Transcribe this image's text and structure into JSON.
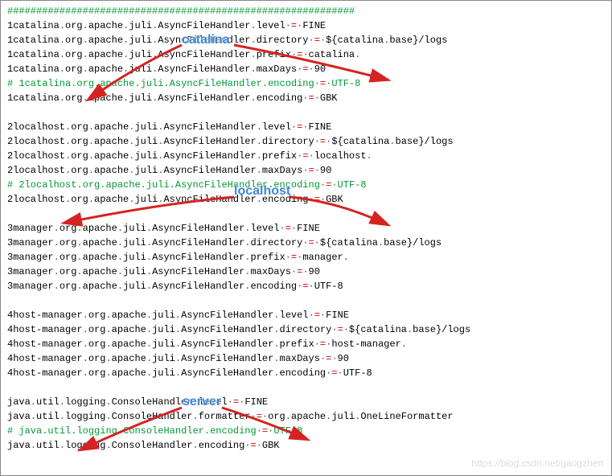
{
  "hash_line": "############################################################",
  "sections": [
    {
      "paragraph_sep_before": false,
      "lines": [
        {
          "type": "prop",
          "text": "1catalina.org.apache.juli.AsyncFileHandler.level = FINE"
        },
        {
          "type": "prop",
          "text": "1catalina.org.apache.juli.AsyncFileHandler.directory = ${catalina.base}/logs"
        },
        {
          "type": "prop",
          "text": "1catalina.org.apache.juli.AsyncFileHandler.prefix = catalina."
        },
        {
          "type": "prop",
          "text": "1catalina.org.apache.juli.AsyncFileHandler.maxDays = 90"
        },
        {
          "type": "comment",
          "text": "# 1catalina.org.apache.juli.AsyncFileHandler.encoding = UTF-8"
        },
        {
          "type": "prop",
          "text": "1catalina.org.apache.juli.AsyncFileHandler.encoding = GBK"
        }
      ]
    },
    {
      "paragraph_sep_before": true,
      "lines": [
        {
          "type": "prop",
          "text": "2localhost.org.apache.juli.AsyncFileHandler.level = FINE"
        },
        {
          "type": "prop",
          "text": "2localhost.org.apache.juli.AsyncFileHandler.directory = ${catalina.base}/logs"
        },
        {
          "type": "prop",
          "text": "2localhost.org.apache.juli.AsyncFileHandler.prefix = localhost."
        },
        {
          "type": "prop",
          "text": "2localhost.org.apache.juli.AsyncFileHandler.maxDays = 90"
        },
        {
          "type": "comment",
          "text": "# 2localhost.org.apache.juli.AsyncFileHandler.encoding = UTF-8"
        },
        {
          "type": "prop",
          "text": "2localhost.org.apache.juli.AsyncFileHandler.encoding = GBK"
        }
      ]
    },
    {
      "paragraph_sep_before": true,
      "lines": [
        {
          "type": "prop",
          "text": "3manager.org.apache.juli.AsyncFileHandler.level = FINE"
        },
        {
          "type": "prop",
          "text": "3manager.org.apache.juli.AsyncFileHandler.directory = ${catalina.base}/logs"
        },
        {
          "type": "prop",
          "text": "3manager.org.apache.juli.AsyncFileHandler.prefix = manager."
        },
        {
          "type": "prop",
          "text": "3manager.org.apache.juli.AsyncFileHandler.maxDays = 90"
        },
        {
          "type": "prop",
          "text": "3manager.org.apache.juli.AsyncFileHandler.encoding = UTF-8"
        }
      ]
    },
    {
      "paragraph_sep_before": true,
      "lines": [
        {
          "type": "prop",
          "text": "4host-manager.org.apache.juli.AsyncFileHandler.level = FINE"
        },
        {
          "type": "prop",
          "text": "4host-manager.org.apache.juli.AsyncFileHandler.directory = ${catalina.base}/logs"
        },
        {
          "type": "prop",
          "text": "4host-manager.org.apache.juli.AsyncFileHandler.prefix = host-manager."
        },
        {
          "type": "prop",
          "text": "4host-manager.org.apache.juli.AsyncFileHandler.maxDays = 90"
        },
        {
          "type": "prop",
          "text": "4host-manager.org.apache.juli.AsyncFileHandler.encoding = UTF-8"
        }
      ]
    },
    {
      "paragraph_sep_before": true,
      "lines": [
        {
          "type": "prop",
          "text": "java.util.logging.ConsoleHandler.level = FINE"
        },
        {
          "type": "prop",
          "text": "java.util.logging.ConsoleHandler.formatter = org.apache.juli.OneLineFormatter"
        },
        {
          "type": "comment",
          "text": "# java.util.logging.ConsoleHandler.encoding = UTF-8"
        },
        {
          "type": "prop",
          "text": "java.util.logging.ConsoleHandler.encoding = GBK"
        }
      ]
    }
  ],
  "annotations": {
    "catalina": "catalina",
    "localhost": "localhost",
    "server": "server"
  },
  "watermark": "https://blog.csdn.net/gaogzhen",
  "colors": {
    "arrow": "#d52323",
    "annot": "#3e87d6"
  }
}
